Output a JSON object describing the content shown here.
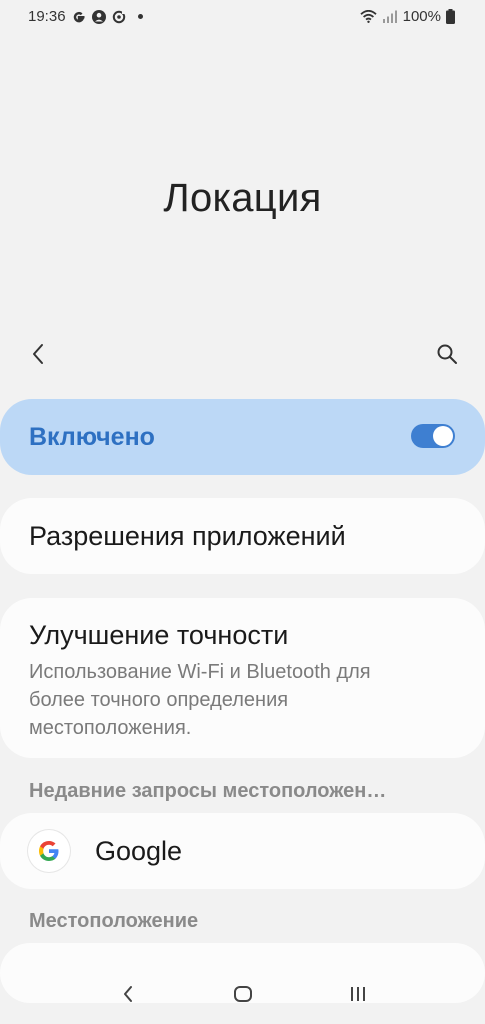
{
  "status_bar": {
    "time": "19:36",
    "battery": "100%",
    "icons": [
      "google-icon",
      "account-icon",
      "sync-icon",
      "notification-dot",
      "wifi-icon",
      "signal-icon",
      "battery-icon"
    ]
  },
  "header": {
    "title": "Локация"
  },
  "toolbar": {
    "back_icon": "chevron-left-icon",
    "search_icon": "search-icon"
  },
  "master_toggle": {
    "label": "Включено",
    "state": "on",
    "accent_color": "#3e7fd1",
    "background_color": "#bcd8f6"
  },
  "items": {
    "app_permissions": "Разрешения приложений",
    "accuracy": {
      "title": "Улучшение точности",
      "description": "Использование Wi-Fi и Bluetooth для более точного определения местоположения."
    }
  },
  "recent_requests": {
    "header": "Недавние запросы местоположен…",
    "apps": [
      {
        "name": "Google",
        "icon": "google-logo-icon"
      }
    ]
  },
  "location_services": {
    "header": "Местоположение"
  },
  "nav_bar": {
    "icons": [
      "back-icon",
      "home-icon",
      "recent-apps-icon"
    ]
  }
}
